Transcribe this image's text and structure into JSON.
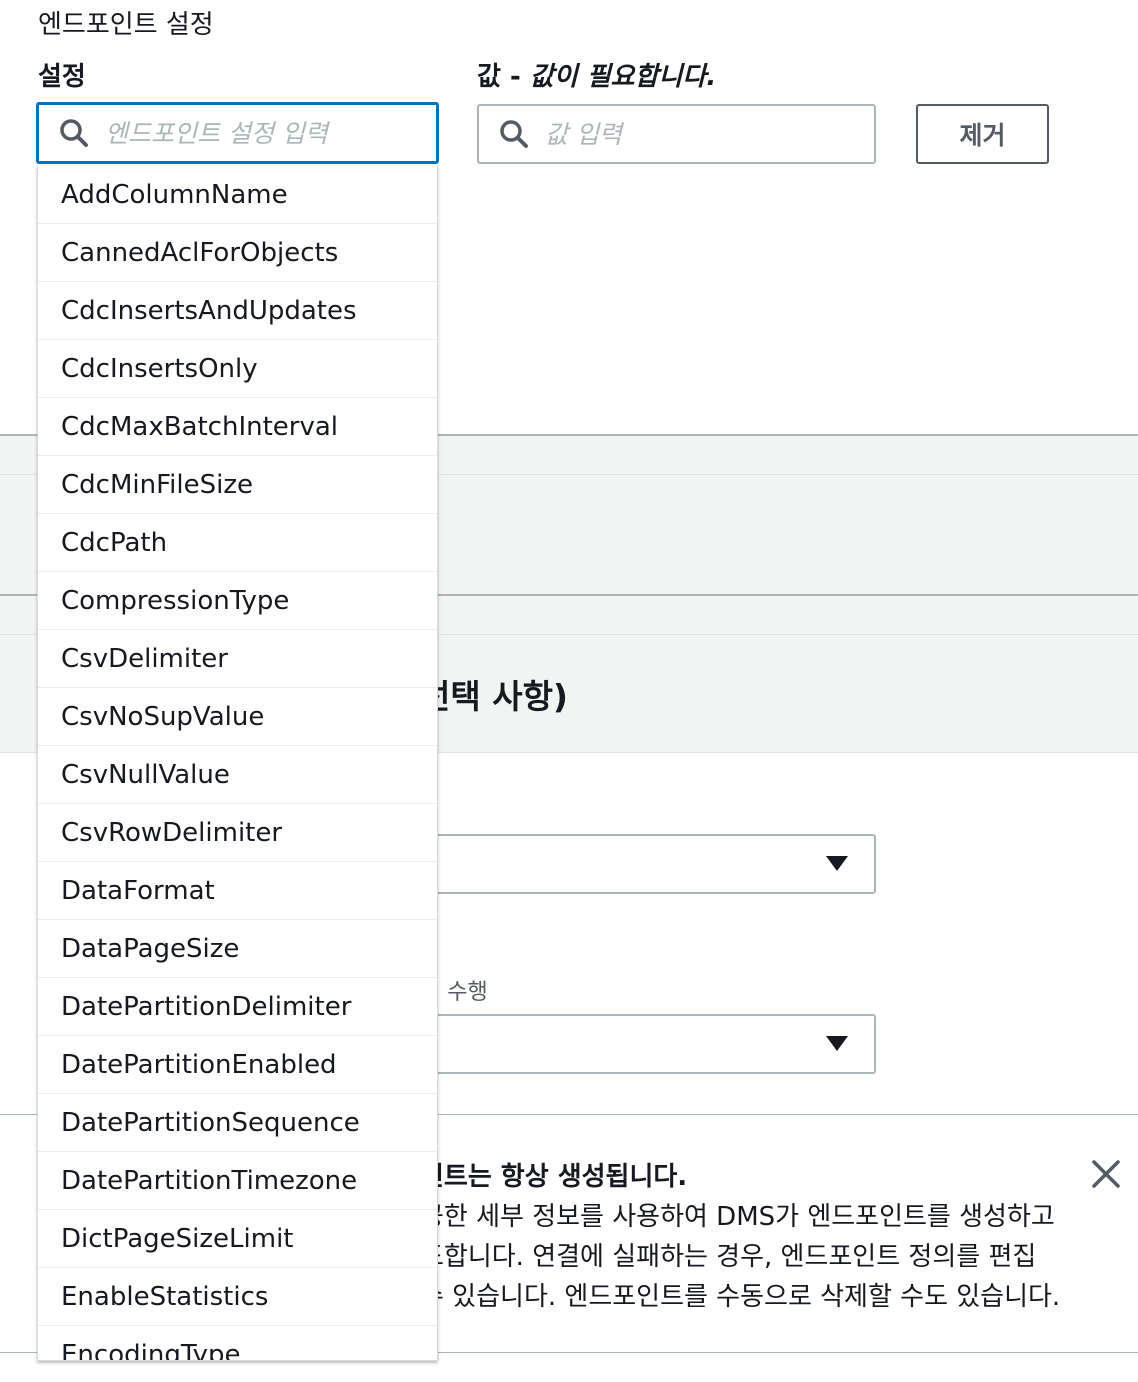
{
  "header": {
    "section_title": "엔드포인트 설정",
    "setting_label": "설정",
    "value_label": "값 - ",
    "value_required": "값이 필요합니다.",
    "setting_placeholder": "엔드포인트 설정 입력",
    "value_placeholder": "값 입력",
    "remove_label": "제거"
  },
  "dropdown": {
    "options": [
      "AddColumnName",
      "CannedAclForObjects",
      "CdcInsertsAndUpdates",
      "CdcInsertsOnly",
      "CdcMaxBatchInterval",
      "CdcMinFileSize",
      "CdcPath",
      "CompressionType",
      "CsvDelimiter",
      "CsvNoSupValue",
      "CsvNullValue",
      "CsvRowDelimiter",
      "DataFormat",
      "DataPageSize",
      "DatePartitionDelimiter",
      "DatePartitionEnabled",
      "DatePartitionSequence",
      "DatePartitionTimezone",
      "DictPageSizeLimit",
      "EnableStatistics",
      "EncodingType"
    ]
  },
  "background": {
    "optional_heading": "선택 사항)",
    "migration_label": "션 수행",
    "info_title": "인트는 항상 생성됩니다.",
    "info_lines": [
      "공한 세부 정보를 사용하여 DMS가 엔드포인트를 생성하고",
      "도합니다. 연결에 실패하는 경우, 엔드포인트 정의를 편집",
      "수 있습니다. 엔드포인트를 수동으로 삭제할 수도 있습니다."
    ]
  },
  "icons": {
    "search": "search-icon",
    "caret": "caret-down-icon",
    "close": "close-icon"
  },
  "colors": {
    "focus_border": "#0073bb",
    "input_border": "#aab7b8",
    "band_background": "#f2f3f3"
  }
}
